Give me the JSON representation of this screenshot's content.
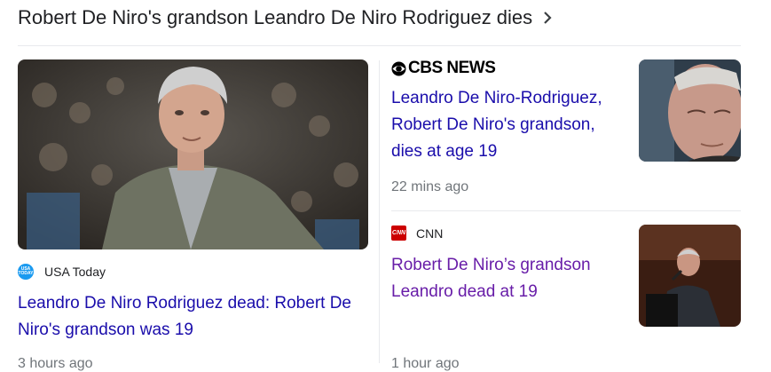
{
  "header": {
    "title": "Robert De Niro's grandson Leandro De Niro Rodriguez dies"
  },
  "icons": {
    "header_chevron": "chevron-right-icon",
    "usa_today": "usa-today-logo",
    "cbs": "cbs-eye-logo",
    "cnn": "cnn-logo"
  },
  "colors": {
    "link": "#1a0dab",
    "visited_link": "#681da8",
    "meta": "#70757a",
    "cnn_red": "#cc0000",
    "usa_blue": "#1a9af0"
  },
  "articles": [
    {
      "source": "USA Today",
      "headline": "Leandro De Niro Rodriguez dead: Robert De Niro's grandson was 19",
      "time": "3 hours ago"
    },
    {
      "source": "CBS NEWS",
      "headline": "Leandro De Niro-Rodriguez, Robert De Niro's grandson, dies at age 19",
      "time": "22 mins ago"
    },
    {
      "source": "CNN",
      "headline": "Robert De Niro’s grandson Leandro dead at 19",
      "time": "1 hour ago"
    }
  ]
}
